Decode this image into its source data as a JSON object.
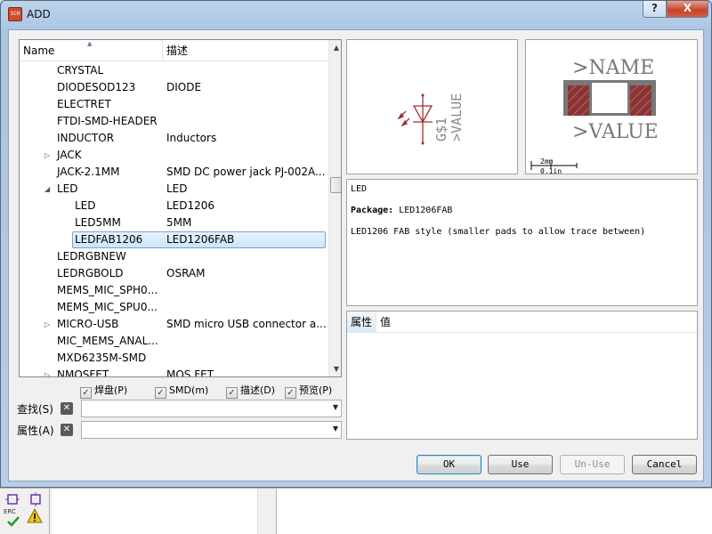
{
  "window": {
    "title": "ADD",
    "icon_label": "SCH",
    "help_label": "?",
    "close_label": "X"
  },
  "tree": {
    "columns": {
      "name": "Name",
      "desc": "描述"
    },
    "rows": [
      {
        "name": "CRYSTAL",
        "desc": "",
        "level": 0,
        "expander": ""
      },
      {
        "name": "DIODESOD123",
        "desc": "DIODE",
        "level": 0,
        "expander": ""
      },
      {
        "name": "ELECTRET",
        "desc": "",
        "level": 0,
        "expander": ""
      },
      {
        "name": "FTDI-SMD-HEADER",
        "desc": "",
        "level": 0,
        "expander": ""
      },
      {
        "name": "INDUCTOR",
        "desc": "Inductors",
        "level": 0,
        "expander": ""
      },
      {
        "name": "JACK",
        "desc": "",
        "level": 0,
        "expander": "▷"
      },
      {
        "name": "JACK-2.1MM",
        "desc": "SMD DC power jack PJ-002A...",
        "level": 0,
        "expander": ""
      },
      {
        "name": "LED",
        "desc": "LED",
        "level": 0,
        "expander": "◢"
      },
      {
        "name": "LED",
        "desc": "LED1206",
        "level": 1,
        "expander": ""
      },
      {
        "name": "LED5MM",
        "desc": "5MM",
        "level": 1,
        "expander": ""
      },
      {
        "name": "LEDFAB1206",
        "desc": "LED1206FAB",
        "level": 1,
        "expander": "",
        "selected": true
      },
      {
        "name": "LEDRGBNEW",
        "desc": "",
        "level": 0,
        "expander": ""
      },
      {
        "name": "LEDRGBOLD",
        "desc": "OSRAM",
        "level": 0,
        "expander": ""
      },
      {
        "name": "MEMS_MIC_SPH0...",
        "desc": "",
        "level": 0,
        "expander": ""
      },
      {
        "name": "MEMS_MIC_SPU0...",
        "desc": "",
        "level": 0,
        "expander": ""
      },
      {
        "name": "MICRO-USB",
        "desc": "SMD micro USB connector a...",
        "level": 0,
        "expander": "▷"
      },
      {
        "name": "MIC_MEMS_ANAL...",
        "desc": "",
        "level": 0,
        "expander": ""
      },
      {
        "name": "MXD6235M-SMD",
        "desc": "",
        "level": 0,
        "expander": ""
      },
      {
        "name": "NMOSFET",
        "desc": "MOS FET",
        "level": 0,
        "expander": "▷"
      }
    ]
  },
  "filters": {
    "pads": {
      "label": "焊盘(P)",
      "checked": true
    },
    "smd": {
      "label": "SMD(m)",
      "checked": true
    },
    "desc": {
      "label": "描述(D)",
      "checked": true
    },
    "preview": {
      "label": "预览(P)",
      "checked": true
    }
  },
  "search": {
    "label": "查找(S)",
    "value": ""
  },
  "attribute": {
    "label": "属性(A)",
    "value": ""
  },
  "preview": {
    "symbol": {
      "name_label": "G$1",
      "value_label": ">VALUE"
    },
    "package": {
      "name_label": ">NAME",
      "value_label": ">VALUE",
      "scale_top": "2mm",
      "scale_bottom": "0.1in"
    }
  },
  "description": {
    "title": "LED",
    "package_key": "Package:",
    "package_value": "LED1206FAB",
    "text": "LED1206 FAB style (smaller pads to allow trace between)"
  },
  "properties": {
    "columns": {
      "attr": "属性",
      "value": "值"
    }
  },
  "buttons": {
    "ok": "OK",
    "use": "Use",
    "unuse": "Un-Use",
    "cancel": "Cancel"
  },
  "background": {
    "erc_label": "ERC"
  },
  "colors": {
    "symbol": "#a03030",
    "package_pad": "#a04040",
    "selection_border": "#7da2ce"
  }
}
